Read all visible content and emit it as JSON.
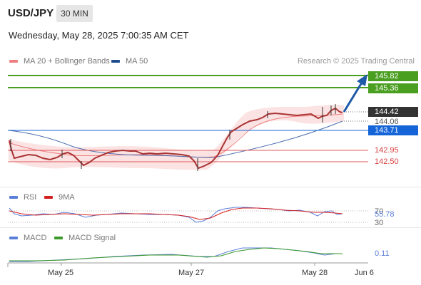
{
  "header": {
    "symbol": "USD/JPY",
    "timeframe": "30 MIN",
    "datetime": "Wednesday, May 28, 2025 7:00:35 AM CET"
  },
  "legend_main": [
    {
      "label": "MA 20 + Bollinger Bands",
      "color": "#f08080"
    },
    {
      "label": "MA 50",
      "color": "#1f4e8c"
    }
  ],
  "copyright": "Research © 2025 Trading Central",
  "price_tags": {
    "target2": "145.82",
    "target1": "145.36",
    "last": "144.42",
    "ma20": "144.06",
    "pivot": "143.71",
    "support1": "142.95",
    "support2": "142.50"
  },
  "rsi_panel": {
    "legend": [
      {
        "label": "RSI",
        "color": "#5b7fd8"
      },
      {
        "label": "9MA",
        "color": "#d62020"
      }
    ],
    "level_high": "70",
    "value": "55.78",
    "level_low": "30"
  },
  "macd_panel": {
    "legend": [
      {
        "label": "MACD",
        "color": "#5b7fd8"
      },
      {
        "label": "MACD Signal",
        "color": "#3a9a2a"
      }
    ],
    "value": "0.11"
  },
  "x_axis": {
    "labels": [
      "May 25",
      "May 27",
      "May 28",
      "Jun 6"
    ]
  },
  "colors": {
    "support_green": "#4a9e20",
    "pivot_blue": "#1565d8",
    "support_red": "#e05a5a",
    "arrow": "#1f5aa8"
  }
}
